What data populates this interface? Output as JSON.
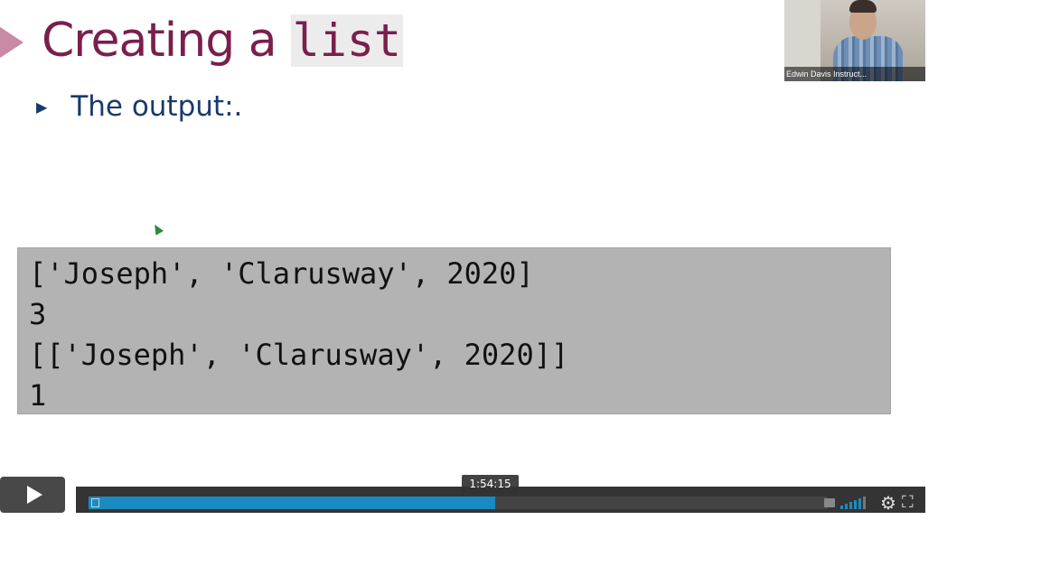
{
  "slide": {
    "title_text": "Creating a",
    "title_code": "list",
    "bullet": "The output:.",
    "output_lines": [
      "['Joseph', 'Clarusway', 2020]",
      "3",
      "[['Joseph', 'Clarusway', 2020]]",
      "1"
    ]
  },
  "webcam": {
    "name_label": "Edwin Davis  Instruct..."
  },
  "player": {
    "hover_time": "1:54:15",
    "progress_fraction": 0.55,
    "accent_color": "#1a8bc1",
    "icons": [
      "play-icon",
      "captions-icon",
      "volume-icon",
      "settings-gear-icon",
      "fullscreen-icon"
    ]
  }
}
